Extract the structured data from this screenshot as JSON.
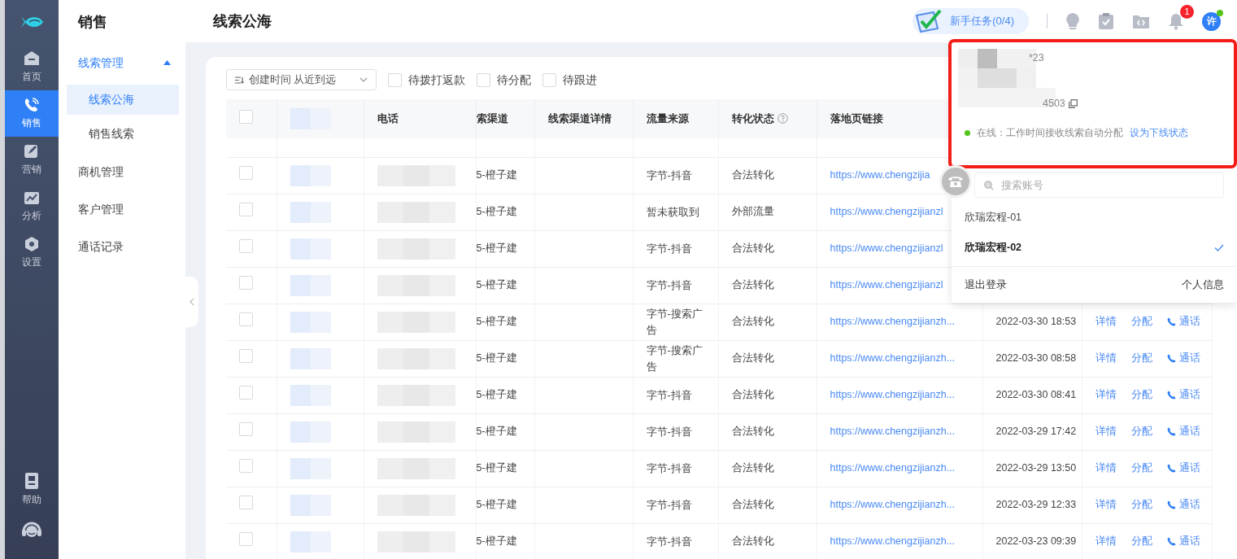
{
  "rail": {
    "items": [
      {
        "label": "首页",
        "selected": false
      },
      {
        "label": "销售",
        "selected": true
      },
      {
        "label": "营销",
        "selected": false
      },
      {
        "label": "分析",
        "selected": false
      },
      {
        "label": "设置",
        "selected": false
      }
    ],
    "bottom_items": [
      {
        "label": "帮助"
      }
    ]
  },
  "subnav": {
    "title": "销售",
    "items": [
      {
        "label": "线索管理",
        "expanded": true,
        "children": [
          {
            "label": "线索公海",
            "selected": true
          },
          {
            "label": "销售线索",
            "selected": false
          }
        ]
      },
      {
        "label": "商机管理"
      },
      {
        "label": "客户管理"
      },
      {
        "label": "通话记录"
      }
    ]
  },
  "page_title": "线索公海",
  "header": {
    "task_button": "新手任务(0/4)",
    "notification_count": "1",
    "avatar": "许",
    "online": true
  },
  "toolbar": {
    "sort": "创建时间 从近到远",
    "filters": [
      {
        "label": "待拨打返款",
        "checked": false
      },
      {
        "label": "待分配",
        "checked": false
      },
      {
        "label": "待跟进",
        "checked": false
      }
    ]
  },
  "table": {
    "all_selected": false,
    "columns": [
      {
        "label": "电话"
      },
      {
        "label": "索渠道"
      },
      {
        "label": "线索渠道详情"
      },
      {
        "label": "流量来源"
      },
      {
        "label": "转化状态",
        "help_icon": true
      },
      {
        "label": "落地页链接"
      }
    ],
    "rows": [
      {
        "selected": false,
        "channel": "5-橙子建",
        "source": "字节-抖音",
        "status": "合法转化",
        "link": "https://www.chengzijia"
      },
      {
        "selected": false,
        "channel": "5-橙子建",
        "source": "暂未获取到",
        "status": "外部流量",
        "link": "https://www.chengzijianzl"
      },
      {
        "selected": false,
        "channel": "5-橙子建",
        "source": "字节-抖音",
        "status": "合法转化",
        "link": "https://www.chengzijianzl"
      },
      {
        "selected": false,
        "channel": "5-橙子建",
        "source": "字节-抖音",
        "status": "合法转化",
        "link": "https://www.chengzijianzl"
      },
      {
        "selected": false,
        "channel": "5-橙子建",
        "source": "字节-搜索广告",
        "status": "合法转化",
        "link": "https://www.chengzijianzh...",
        "created": "2022-03-30 18:53",
        "actions": [
          {
            "kind": "link",
            "label": "详情"
          },
          {
            "kind": "link",
            "label": "分配"
          },
          {
            "kind": "call",
            "label": "通话"
          }
        ]
      },
      {
        "selected": false,
        "channel": "5-橙子建",
        "source": "字节-搜索广告",
        "status": "合法转化",
        "link": "https://www.chengzijianzh...",
        "created": "2022-03-30 08:58",
        "actions": [
          {
            "kind": "link",
            "label": "详情"
          },
          {
            "kind": "link",
            "label": "分配"
          },
          {
            "kind": "call",
            "label": "通话"
          }
        ]
      },
      {
        "selected": false,
        "channel": "5-橙子建",
        "source": "字节-抖音",
        "status": "合法转化",
        "link": "https://www.chengzijianzh...",
        "created": "2022-03-30 08:41",
        "actions": [
          {
            "kind": "link",
            "label": "详情"
          },
          {
            "kind": "link",
            "label": "分配"
          },
          {
            "kind": "call",
            "label": "通话"
          }
        ]
      },
      {
        "selected": false,
        "channel": "5-橙子建",
        "source": "字节-抖音",
        "status": "合法转化",
        "link": "https://www.chengzijianzh...",
        "created": "2022-03-29 17:42",
        "actions": [
          {
            "kind": "link",
            "label": "详情"
          },
          {
            "kind": "link",
            "label": "分配"
          },
          {
            "kind": "call",
            "label": "通话"
          }
        ]
      },
      {
        "selected": false,
        "channel": "5-橙子建",
        "source": "字节-抖音",
        "status": "合法转化",
        "link": "https://www.chengzijianzh...",
        "created": "2022-03-29 13:50",
        "actions": [
          {
            "kind": "link",
            "label": "详情"
          },
          {
            "kind": "link",
            "label": "分配"
          },
          {
            "kind": "call",
            "label": "通话"
          }
        ]
      },
      {
        "selected": false,
        "channel": "5-橙子建",
        "source": "字节-抖音",
        "status": "合法转化",
        "link": "https://www.chengzijianzh...",
        "created": "2022-03-29 12:33",
        "actions": [
          {
            "kind": "link",
            "label": "详情"
          },
          {
            "kind": "link",
            "label": "分配"
          },
          {
            "kind": "call",
            "label": "通话"
          }
        ]
      },
      {
        "selected": false,
        "channel": "5-橙子建",
        "source": "字节-抖音",
        "status": "合法转化",
        "link": "https://www.chengzijianzh...",
        "created": "2022-03-23 09:39",
        "actions": [
          {
            "kind": "link",
            "label": "详情"
          },
          {
            "kind": "link",
            "label": "分配"
          },
          {
            "kind": "call",
            "label": "通话"
          }
        ]
      }
    ]
  },
  "account_menu": {
    "masked_name": "*23",
    "masked_id": "4503",
    "online": true,
    "status_text": "在线：工作时间接收线索自动分配",
    "status_action": "设为下线状态",
    "search_placeholder": "搜索账号",
    "accounts": [
      {
        "name": "欣瑞宏程-01",
        "selected": false
      },
      {
        "name": "欣瑞宏程-02",
        "selected": true
      }
    ],
    "logout": "退出登录",
    "profile": "个人信息"
  }
}
